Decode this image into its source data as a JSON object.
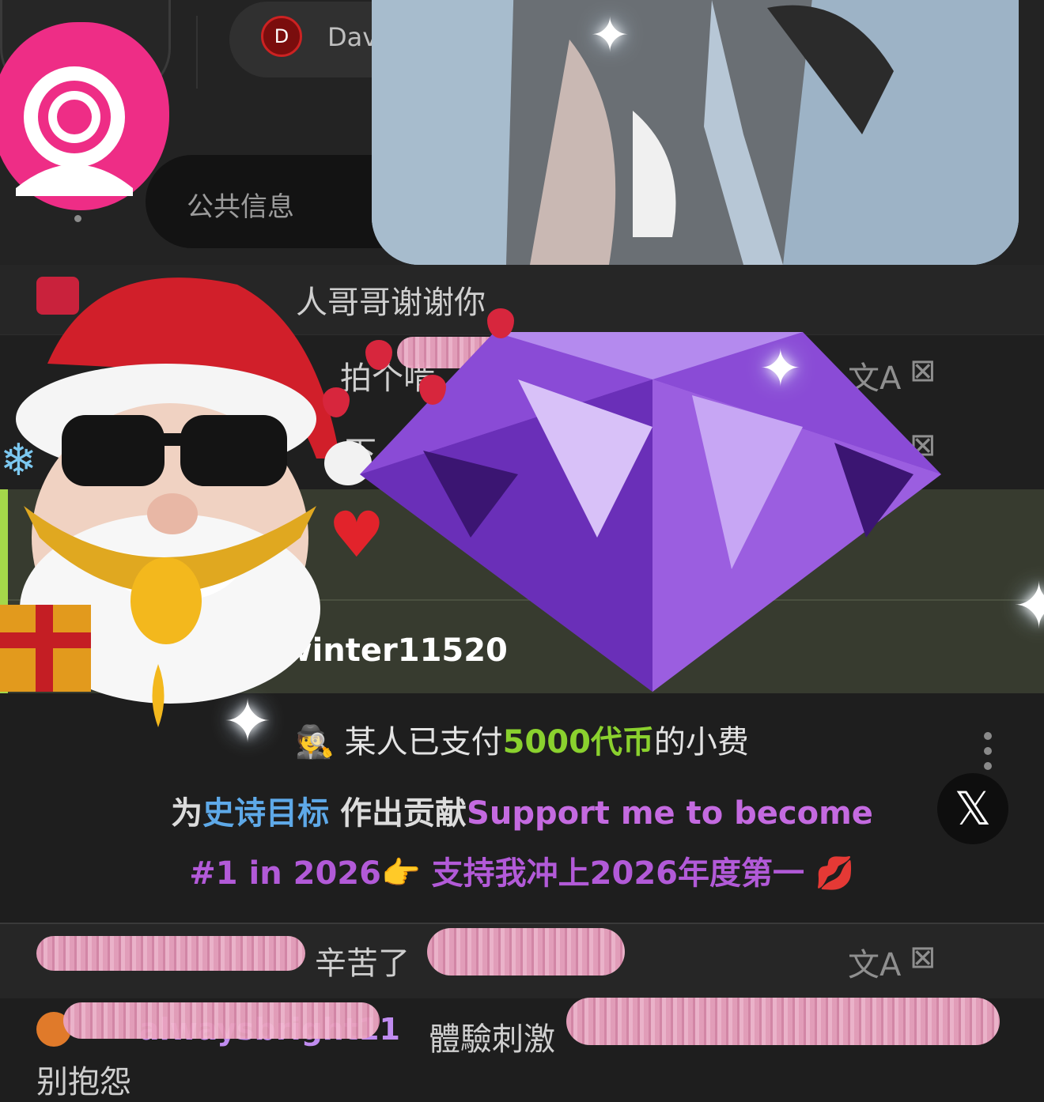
{
  "header": {
    "user_initial": "D",
    "user_name_partial": "Dav",
    "tab_label": "公共信息"
  },
  "chat": {
    "row1_text": "人哥哥谢谢你",
    "row2_text": "拍个啃",
    "row3_text": "一下",
    "highlight_text": "海...直播,X:winter11520",
    "bottom_row1_text": "辛苦了",
    "bottom_row2_username": "alwaysbright11",
    "bottom_row2_text": "體驗刺激",
    "bottom_row2_cont": "别抱怨"
  },
  "tip": {
    "prefix": "某人已支付",
    "amount": "5000代币",
    "suffix": "的小费",
    "line2_a": "为",
    "line2_b": "史诗目标",
    "line2_c": " 作出贡献",
    "line2_d": "Support me to become",
    "line3_a": "#1 in 2026",
    "line3_b": "👉 支持我冲上2026年度第一 💋"
  },
  "icons": {
    "translate": "translate-icon",
    "report": "report-icon",
    "close": "x-icon",
    "more": "kebab-menu-icon",
    "logo": "webcam-logo-icon"
  },
  "colors": {
    "accent_green": "#8ad12e",
    "accent_purple": "#b25ad8",
    "accent_blue": "#5ea9e8",
    "brand_pink": "#ee2d86"
  }
}
